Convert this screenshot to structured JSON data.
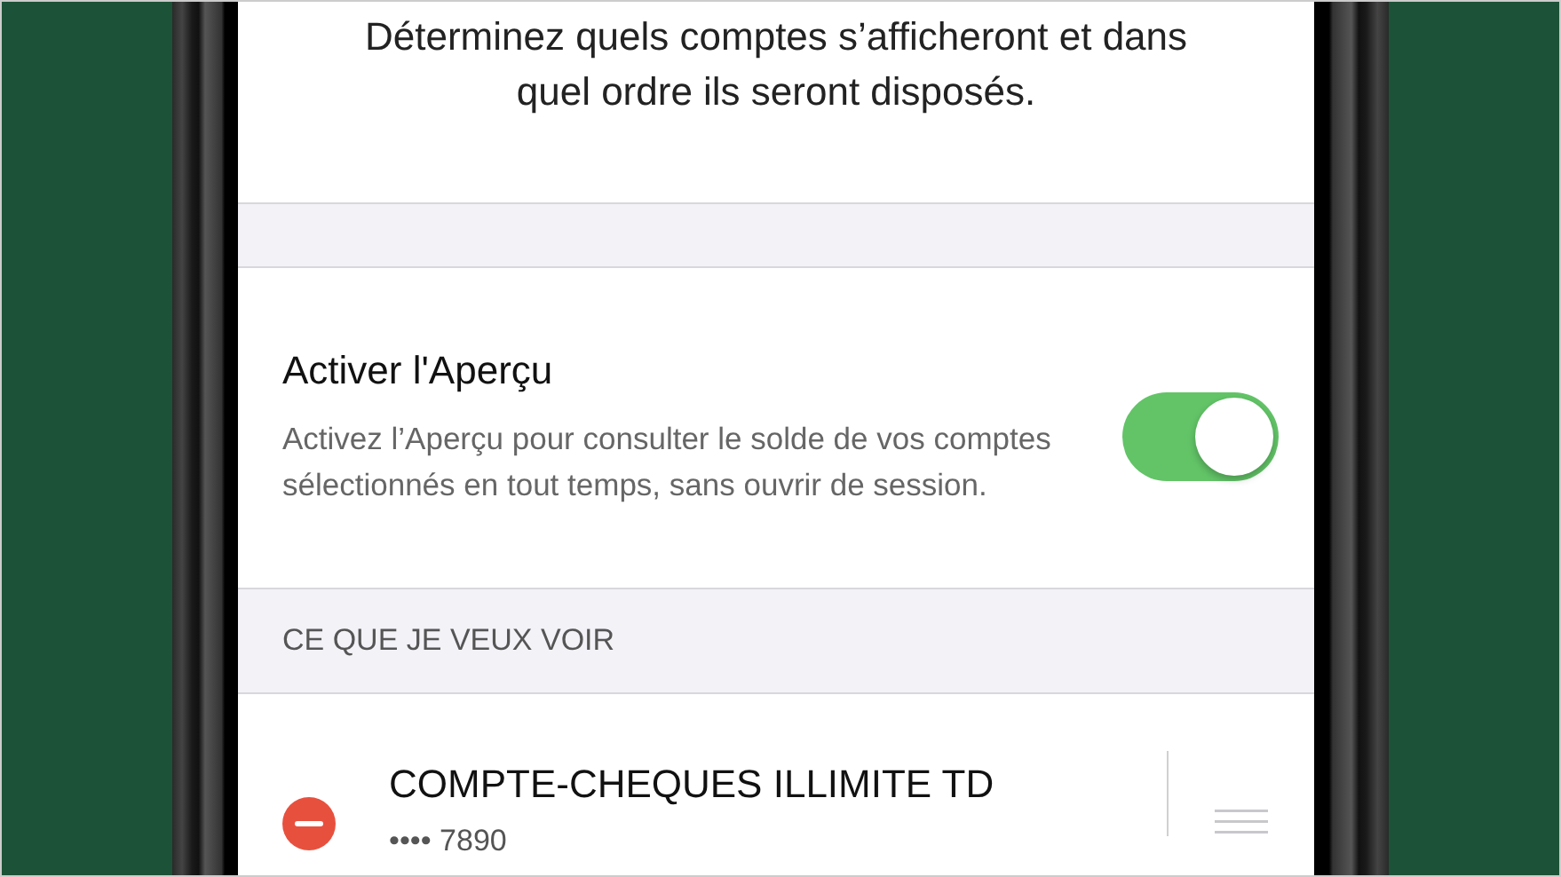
{
  "intro": "Déterminez quels comptes s’afficheront et dans quel ordre ils seront disposés.",
  "preview_setting": {
    "title": "Activer l'Aperçu",
    "description": "Activez l’Aperçu pour consulter le solde de vos comptes sélectionnés en tout temps, sans ouvrir de session.",
    "on": true
  },
  "section_header": "CE QUE JE VEUX VOIR",
  "accounts": [
    {
      "name": "COMPTE-CHEQUES ILLIMITE TD",
      "number": "•••• 7890"
    }
  ]
}
